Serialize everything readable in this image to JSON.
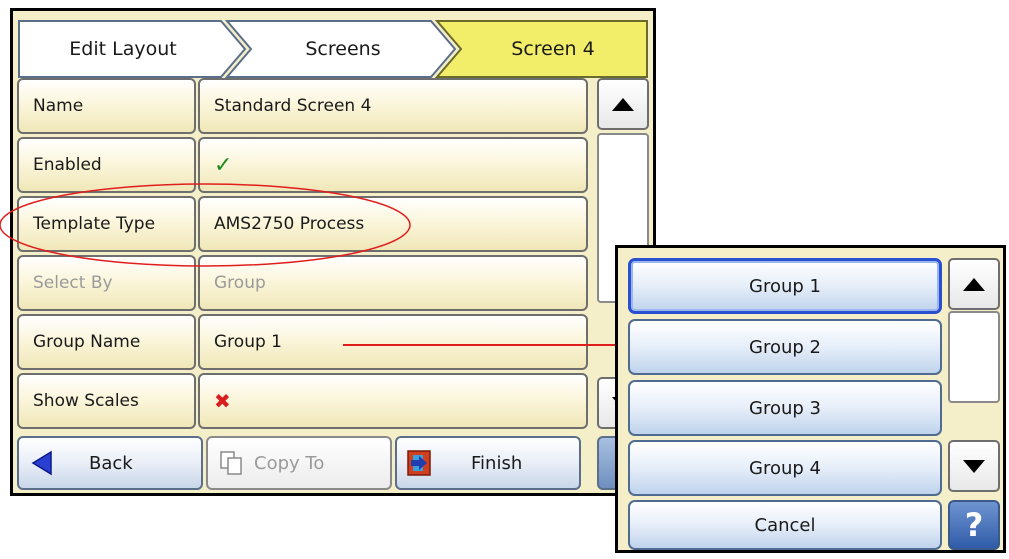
{
  "breadcrumb": {
    "edit_layout": "Edit Layout",
    "screens": "Screens",
    "current": "Screen 4"
  },
  "fields": {
    "name": {
      "label": "Name",
      "value": "Standard Screen 4"
    },
    "enabled": {
      "label": "Enabled",
      "value": "✓"
    },
    "template_type": {
      "label": "Template Type",
      "value": "AMS2750 Process"
    },
    "select_by": {
      "label": "Select By",
      "value": "Group"
    },
    "group_name": {
      "label": "Group Name",
      "value": "Group 1"
    },
    "show_scales": {
      "label": "Show Scales",
      "value": "✖"
    }
  },
  "bottom_bar": {
    "back": "Back",
    "copy_to": "Copy To",
    "finish": "Finish"
  },
  "popup": {
    "options": [
      "Group 1",
      "Group 2",
      "Group 3",
      "Group 4"
    ],
    "cancel": "Cancel",
    "help": "?"
  },
  "colors": {
    "panel_bg": "#f5efc9",
    "active_crumb": "#f2ee6a",
    "check_green": "#1b8a1b",
    "cross_red": "#d81e1e",
    "annotation_red": "#e01e1e"
  },
  "icons": {
    "back": "left-arrow-icon",
    "copy": "copy-icon",
    "finish": "finish-icon",
    "help": "question-mark-icon",
    "up": "arrow-up-icon",
    "down": "arrow-down-icon"
  }
}
